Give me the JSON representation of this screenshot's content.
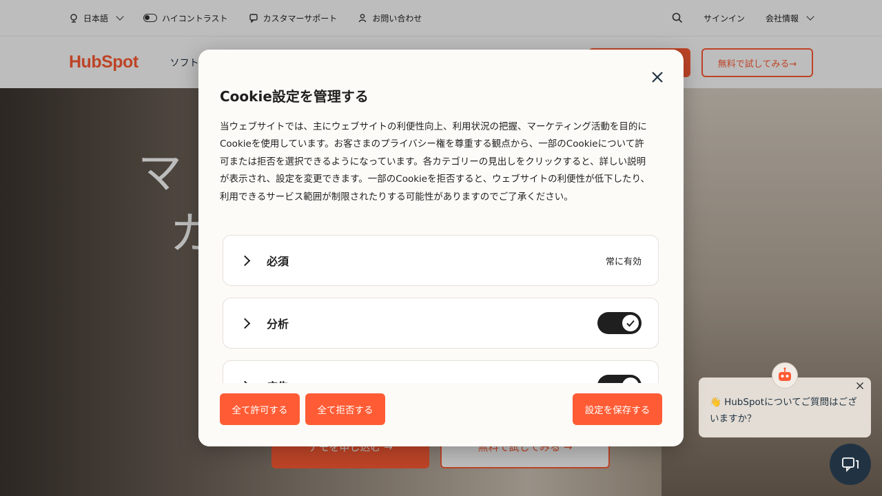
{
  "utility_bar": {
    "language": "日本語",
    "contrast": "ハイコントラスト",
    "support": "カスタマーサポート",
    "contact": "お問い合わせ",
    "signin": "サインイン",
    "company": "会社情報"
  },
  "nav": {
    "logo": "HubSpot",
    "software": "ソフト",
    "trial": "無料で試してみる→"
  },
  "hero": {
    "line1": "マ",
    "line2": "カ",
    "cta_demo": "デモを申し込む →",
    "cta_trial": "無料で試してみる →"
  },
  "modal": {
    "title": "Cookie設定を管理する",
    "description": "当ウェブサイトでは、主にウェブサイトの利便性向上、利用状況の把握、マーケティング活動を目的にCookieを使用しています。お客さまのプライバシー権を尊重する観点から、一部のCookieについて許可または拒否を選択できるようになっています。各カテゴリーの見出しをクリックすると、詳しい説明が表示され、設定を変更できます。一部のCookieを拒否すると、ウェブサイトの利便性が低下したり、利用できるサービス範囲が制限されたりする可能性がありますのでご了承ください。",
    "categories": [
      {
        "label": "必須",
        "status": "常に有効"
      },
      {
        "label": "分析",
        "enabled": true
      },
      {
        "label": "広告",
        "enabled": true
      }
    ],
    "accept_all": "全て許可する",
    "reject_all": "全て拒否する",
    "save": "設定を保存する"
  },
  "chat": {
    "message": "👋 HubSpotについてご質問はございますか？"
  },
  "colors": {
    "brand": "#ff5c35",
    "toggle_on": "#1f1f1f",
    "modal_bg": "#fdfbf7"
  }
}
